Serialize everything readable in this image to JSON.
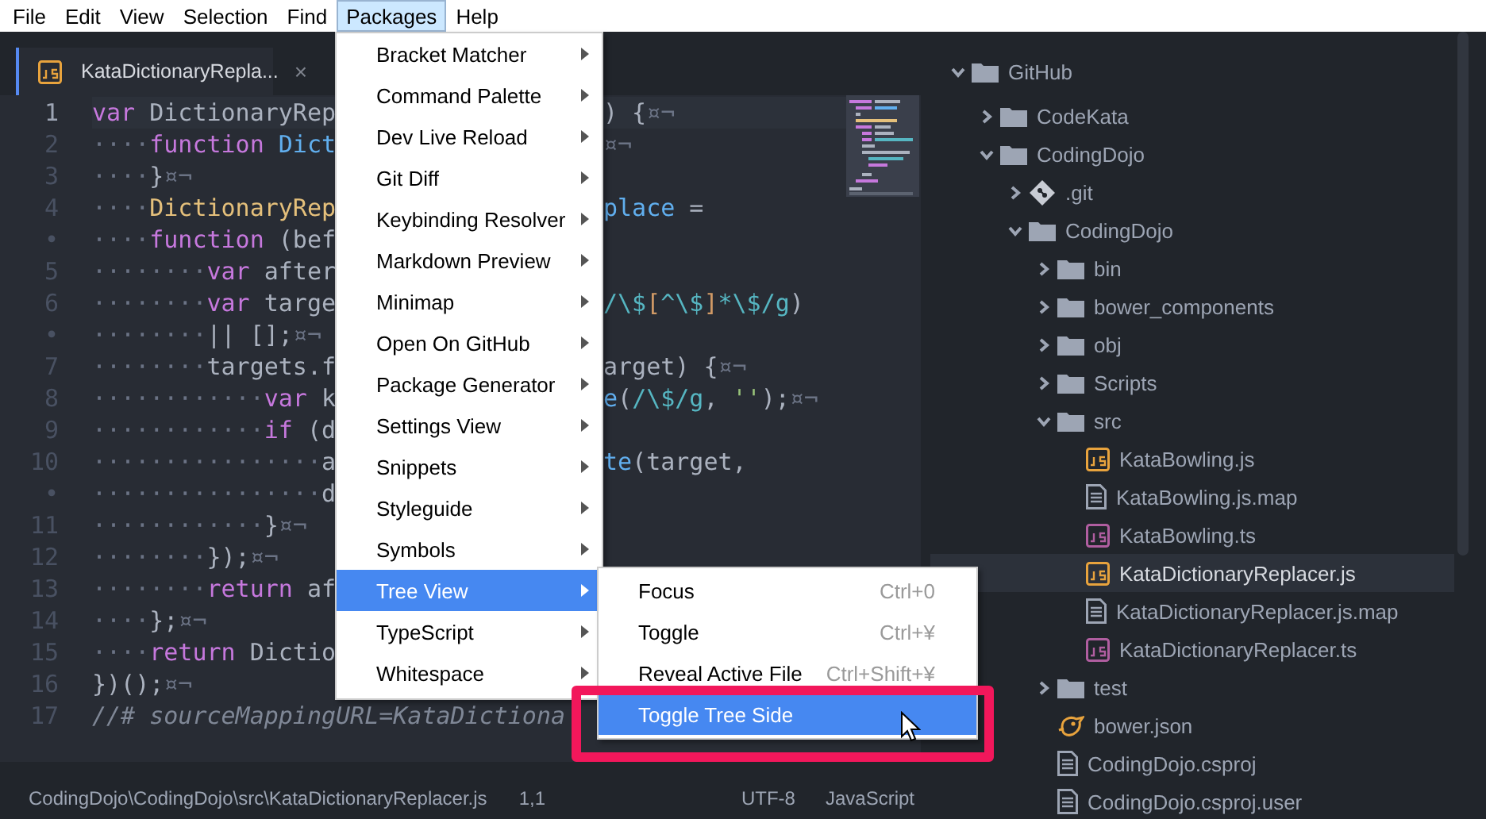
{
  "menubar": [
    {
      "label": "File",
      "selected": false
    },
    {
      "label": "Edit",
      "selected": false
    },
    {
      "label": "View",
      "selected": false
    },
    {
      "label": "Selection",
      "selected": false
    },
    {
      "label": "Find",
      "selected": false
    },
    {
      "label": "Packages",
      "selected": true
    },
    {
      "label": "Help",
      "selected": false
    }
  ],
  "tab": {
    "title": "KataDictionaryRepla...",
    "close": "×",
    "selected": true
  },
  "code_lines": [
    {
      "number": "1",
      "current": true,
      "left": [
        {
          "kind": "keyword",
          "text": "var"
        },
        {
          "kind": "plain",
          "text": " DictionaryRep"
        }
      ],
      "right": [
        {
          "kind": "plain",
          "text": ") {"
        },
        {
          "kind": "invisible",
          "text": "¤¬"
        }
      ]
    },
    {
      "number": "2",
      "current": false,
      "left": [
        {
          "kind": "indent",
          "text": "····"
        },
        {
          "kind": "keyword",
          "text": "function"
        },
        {
          "kind": "function",
          "text": " Dict"
        }
      ],
      "right": [
        {
          "kind": "invisible",
          "text": "¤¬"
        }
      ]
    },
    {
      "number": "3",
      "current": false,
      "left": [
        {
          "kind": "indent",
          "text": "····"
        },
        {
          "kind": "plain",
          "text": "}"
        },
        {
          "kind": "invisible",
          "text": "¤¬"
        }
      ]
    },
    {
      "number": "4",
      "current": false,
      "left": [
        {
          "kind": "indent",
          "text": "····"
        },
        {
          "kind": "class",
          "text": "DictionaryRep"
        }
      ],
      "right": [
        {
          "kind": "function",
          "text": "place"
        },
        {
          "kind": "plain",
          "text": " ="
        }
      ]
    },
    {
      "number": "•",
      "current": false,
      "left": [
        {
          "kind": "indent",
          "text": "····"
        },
        {
          "kind": "keyword",
          "text": "function"
        },
        {
          "kind": "plain",
          "text": " (bef"
        }
      ]
    },
    {
      "number": "5",
      "current": false,
      "left": [
        {
          "kind": "indent",
          "text": "········"
        },
        {
          "kind": "keyword",
          "text": "var"
        },
        {
          "kind": "plain",
          "text": " after"
        }
      ]
    },
    {
      "number": "6",
      "current": false,
      "left": [
        {
          "kind": "indent",
          "text": "········"
        },
        {
          "kind": "keyword",
          "text": "var"
        },
        {
          "kind": "plain",
          "text": " targe"
        }
      ],
      "right": [
        {
          "kind": "regex",
          "text": "/\\$"
        },
        {
          "kind": "bracket",
          "text": "["
        },
        {
          "kind": "regex",
          "text": "^\\$"
        },
        {
          "kind": "bracket",
          "text": "]"
        },
        {
          "kind": "regex",
          "text": "*\\$/g"
        },
        {
          "kind": "plain",
          "text": ")"
        }
      ]
    },
    {
      "number": "•",
      "current": false,
      "left": [
        {
          "kind": "indent",
          "text": "········"
        },
        {
          "kind": "plain",
          "text": "|| [];"
        },
        {
          "kind": "invisible",
          "text": "¤¬"
        }
      ]
    },
    {
      "number": "7",
      "current": false,
      "left": [
        {
          "kind": "indent",
          "text": "········"
        },
        {
          "kind": "plain",
          "text": "targets.f"
        }
      ],
      "right": [
        {
          "kind": "plain",
          "text": "arget) {"
        },
        {
          "kind": "invisible",
          "text": "¤¬"
        }
      ]
    },
    {
      "number": "8",
      "current": false,
      "left": [
        {
          "kind": "indent",
          "text": "············"
        },
        {
          "kind": "keyword",
          "text": "var"
        },
        {
          "kind": "plain",
          "text": " k"
        }
      ],
      "right": [
        {
          "kind": "function",
          "text": "e"
        },
        {
          "kind": "plain",
          "text": "("
        },
        {
          "kind": "regex",
          "text": "/\\$/g"
        },
        {
          "kind": "plain",
          "text": ", "
        },
        {
          "kind": "string",
          "text": "''"
        },
        {
          "kind": "plain",
          "text": ");"
        },
        {
          "kind": "invisible",
          "text": "¤¬"
        }
      ]
    },
    {
      "number": "9",
      "current": false,
      "left": [
        {
          "kind": "indent",
          "text": "············"
        },
        {
          "kind": "keyword",
          "text": "if"
        },
        {
          "kind": "plain",
          "text": " (d"
        }
      ]
    },
    {
      "number": "10",
      "current": false,
      "left": [
        {
          "kind": "indent",
          "text": "················"
        },
        {
          "kind": "plain",
          "text": "a"
        }
      ],
      "right": [
        {
          "kind": "function",
          "text": "te"
        },
        {
          "kind": "plain",
          "text": "(target,"
        }
      ]
    },
    {
      "number": "•",
      "current": false,
      "left": [
        {
          "kind": "indent",
          "text": "················"
        },
        {
          "kind": "plain",
          "text": "d"
        }
      ]
    },
    {
      "number": "11",
      "current": false,
      "left": [
        {
          "kind": "indent",
          "text": "············"
        },
        {
          "kind": "plain",
          "text": "}"
        },
        {
          "kind": "invisible",
          "text": "¤¬"
        }
      ]
    },
    {
      "number": "12",
      "current": false,
      "left": [
        {
          "kind": "indent",
          "text": "········"
        },
        {
          "kind": "plain",
          "text": "});"
        },
        {
          "kind": "invisible",
          "text": "¤¬"
        }
      ]
    },
    {
      "number": "13",
      "current": false,
      "left": [
        {
          "kind": "indent",
          "text": "········"
        },
        {
          "kind": "keyword",
          "text": "return"
        },
        {
          "kind": "plain",
          "text": " af"
        }
      ]
    },
    {
      "number": "14",
      "current": false,
      "left": [
        {
          "kind": "indent",
          "text": "····"
        },
        {
          "kind": "plain",
          "text": "};"
        },
        {
          "kind": "invisible",
          "text": "¤¬"
        }
      ]
    },
    {
      "number": "15",
      "current": false,
      "left": [
        {
          "kind": "indent",
          "text": "····"
        },
        {
          "kind": "keyword",
          "text": "return"
        },
        {
          "kind": "plain",
          "text": " Dictio"
        }
      ]
    },
    {
      "number": "16",
      "current": false,
      "left": [
        {
          "kind": "plain",
          "text": "})();"
        },
        {
          "kind": "invisible",
          "text": "¤¬"
        }
      ]
    },
    {
      "number": "17",
      "current": false,
      "left": [
        {
          "kind": "comment",
          "text": "//# sourceMappingURL=KataDictiona"
        }
      ]
    }
  ],
  "packages_menu": [
    {
      "label": "Bracket Matcher",
      "submenu": true,
      "selected": false
    },
    {
      "label": "Command Palette",
      "submenu": true,
      "selected": false
    },
    {
      "label": "Dev Live Reload",
      "submenu": true,
      "selected": false
    },
    {
      "label": "Git Diff",
      "submenu": true,
      "selected": false
    },
    {
      "label": "Keybinding Resolver",
      "submenu": true,
      "selected": false
    },
    {
      "label": "Markdown Preview",
      "submenu": true,
      "selected": false
    },
    {
      "label": "Minimap",
      "submenu": true,
      "selected": false
    },
    {
      "label": "Open On GitHub",
      "submenu": true,
      "selected": false
    },
    {
      "label": "Package Generator",
      "submenu": true,
      "selected": false
    },
    {
      "label": "Settings View",
      "submenu": true,
      "selected": false
    },
    {
      "label": "Snippets",
      "submenu": true,
      "selected": false
    },
    {
      "label": "Styleguide",
      "submenu": true,
      "selected": false
    },
    {
      "label": "Symbols",
      "submenu": true,
      "selected": false
    },
    {
      "label": "Tree View",
      "submenu": true,
      "selected": true
    },
    {
      "label": "TypeScript",
      "submenu": true,
      "selected": false
    },
    {
      "label": "Whitespace",
      "submenu": true,
      "selected": false
    }
  ],
  "tree_view_submenu": [
    {
      "label": "Focus",
      "shortcut": "Ctrl+0",
      "selected": false
    },
    {
      "label": "Toggle",
      "shortcut": "Ctrl+¥",
      "selected": false
    },
    {
      "label": "Reveal Active File",
      "shortcut": "Ctrl+Shift+¥",
      "selected": false
    },
    {
      "label": "Toggle Tree Side",
      "selected": true
    }
  ],
  "tree": {
    "label": "GitHub",
    "kind": "folder",
    "expanded": true,
    "selected": false,
    "children": [
      {
        "label": "CodeKata",
        "kind": "folder",
        "expanded": false,
        "selected": false
      },
      {
        "label": "CodingDojo",
        "kind": "folder",
        "expanded": true,
        "selected": false,
        "children": [
          {
            "label": ".git",
            "kind": "repo",
            "expanded": false,
            "selected": false
          },
          {
            "label": "CodingDojo",
            "kind": "folder",
            "expanded": true,
            "selected": false,
            "children": [
              {
                "label": "bin",
                "kind": "folder",
                "expanded": false,
                "selected": false
              },
              {
                "label": "bower_components",
                "kind": "folder",
                "expanded": false,
                "selected": false
              },
              {
                "label": "obj",
                "kind": "folder",
                "expanded": false,
                "selected": false
              },
              {
                "label": "Scripts",
                "kind": "folder",
                "expanded": false,
                "selected": false
              },
              {
                "label": "src",
                "kind": "folder",
                "expanded": true,
                "selected": false,
                "children": [
                  {
                    "label": "KataBowling.js",
                    "kind": "js",
                    "selected": false
                  },
                  {
                    "label": "KataBowling.js.map",
                    "kind": "doc",
                    "selected": false
                  },
                  {
                    "label": "KataBowling.ts",
                    "kind": "ts",
                    "selected": false
                  },
                  {
                    "label": "KataDictionaryReplacer.js",
                    "kind": "js",
                    "selected": true
                  },
                  {
                    "label": "KataDictionaryReplacer.js.map",
                    "kind": "doc",
                    "selected": false
                  },
                  {
                    "label": "KataDictionaryReplacer.ts",
                    "kind": "ts",
                    "selected": false
                  }
                ]
              },
              {
                "label": "test",
                "kind": "folder",
                "expanded": false,
                "selected": false
              },
              {
                "label": "bower.json",
                "kind": "bower",
                "selected": false
              },
              {
                "label": "CodingDojo.csproj",
                "kind": "doc",
                "selected": false
              },
              {
                "label": "CodingDojo.csproj.user",
                "kind": "doc",
                "selected": false
              }
            ]
          }
        ]
      }
    ]
  },
  "status_bar": {
    "path": "CodingDojo\\CodingDojo\\src\\KataDictionaryReplacer.js",
    "cursor": "1,1",
    "encoding": "UTF-8",
    "grammar": "JavaScript"
  }
}
